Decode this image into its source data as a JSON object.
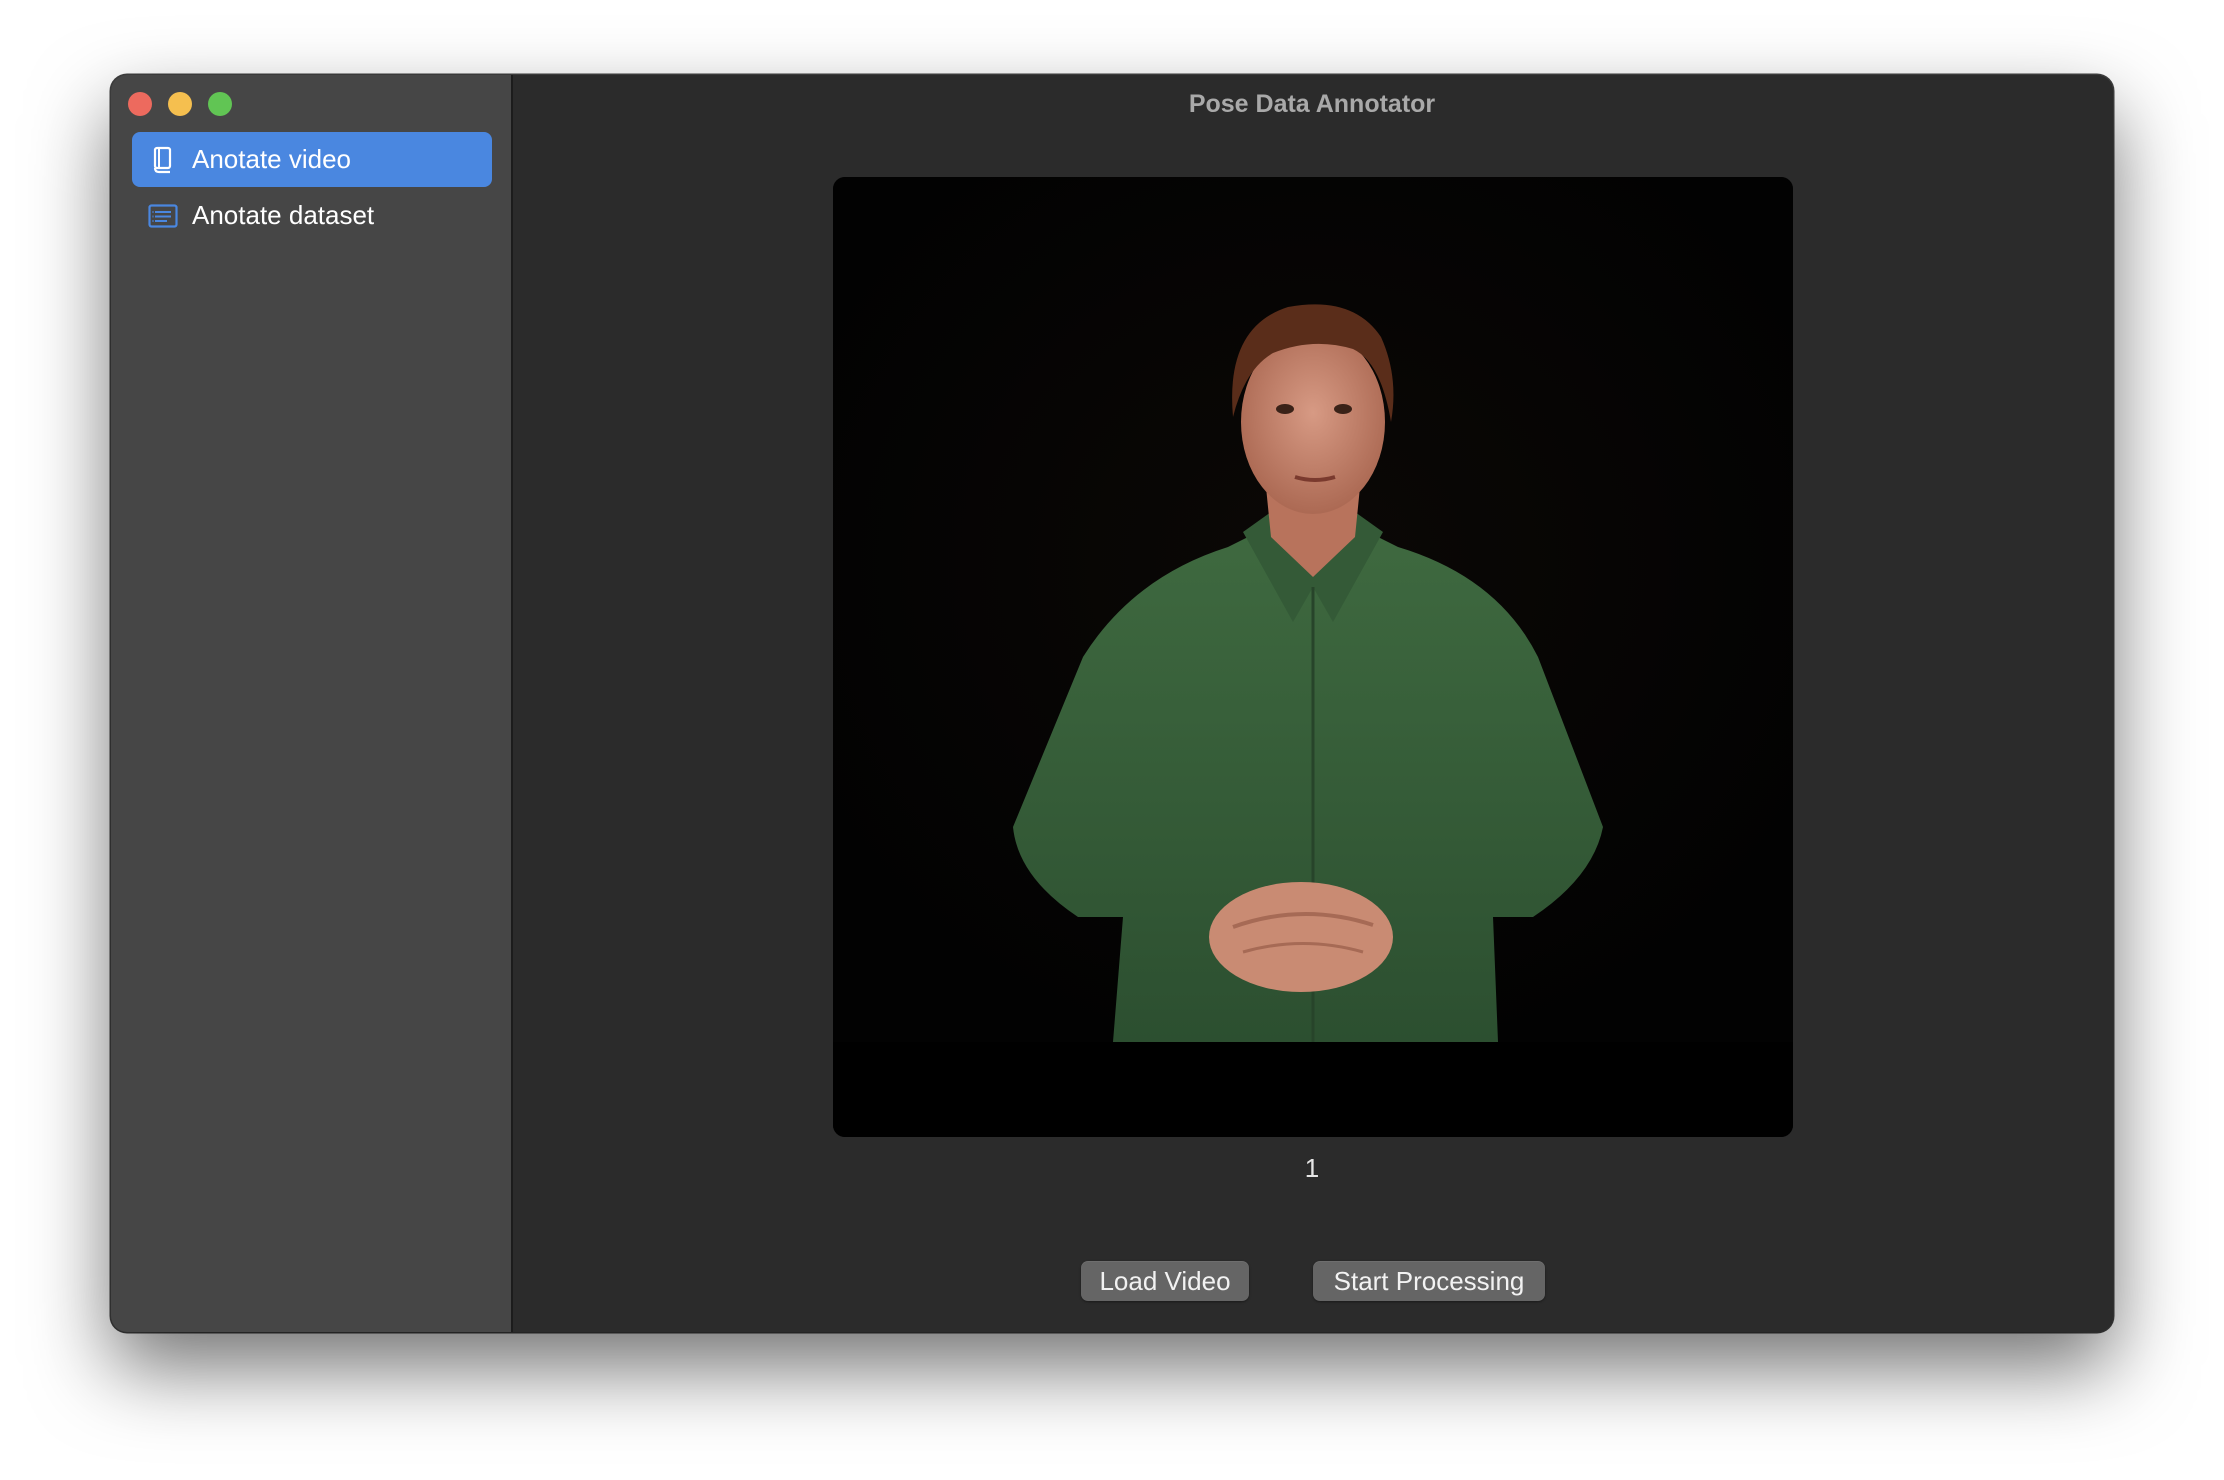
{
  "window": {
    "title": "Pose Data Annotator"
  },
  "sidebar": {
    "items": [
      {
        "label": "Anotate video",
        "icon": "book-icon",
        "selected": true
      },
      {
        "label": "Anotate dataset",
        "icon": "list-icon",
        "selected": false
      }
    ]
  },
  "main": {
    "video": {
      "description_icon": "video-frame",
      "frame_number": "1"
    },
    "buttons": {
      "load_video": "Load Video",
      "start_processing": "Start Processing"
    }
  },
  "colors": {
    "accent": "#4a87e0",
    "close": "#ed6a5e",
    "minimize": "#f5bf4f",
    "zoom": "#61c554"
  }
}
